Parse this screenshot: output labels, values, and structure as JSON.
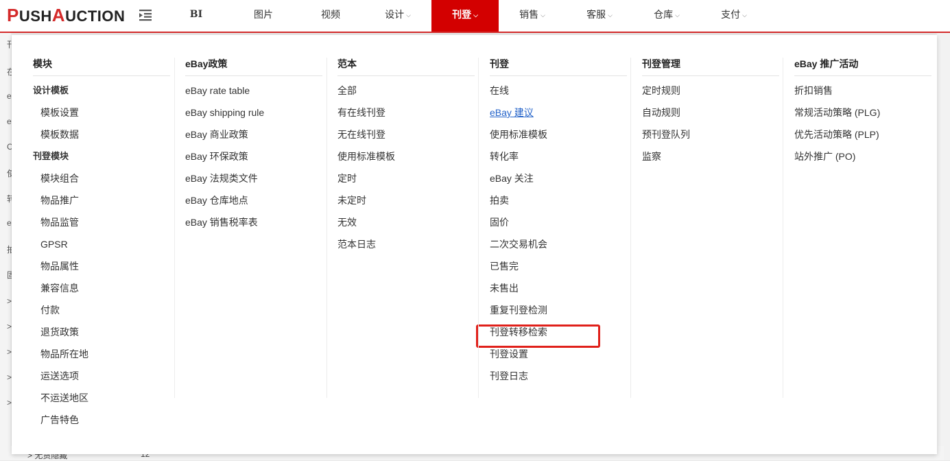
{
  "logo": {
    "p": "P",
    "ush": "USH",
    "a": "A",
    "uction": "UCTION"
  },
  "nav": [
    {
      "label": "BI",
      "dropdown": false
    },
    {
      "label": "图片",
      "dropdown": false
    },
    {
      "label": "视频",
      "dropdown": false
    },
    {
      "label": "设计",
      "dropdown": true
    },
    {
      "label": "刊登",
      "dropdown": true,
      "active": true
    },
    {
      "label": "销售",
      "dropdown": true
    },
    {
      "label": "客服",
      "dropdown": true
    },
    {
      "label": "仓库",
      "dropdown": true
    },
    {
      "label": "支付",
      "dropdown": true
    }
  ],
  "chevron": "⌵",
  "background": {
    "left_glyphs": [
      "刊",
      "在",
      "e",
      "e",
      "C",
      "使",
      "转",
      "e",
      "拍",
      "固",
      ">",
      ">",
      ">",
      ">",
      ">"
    ],
    "bottom_text": "> 无货隐藏",
    "bottom_count": "12"
  },
  "columns": [
    {
      "title": "模块",
      "entries": [
        {
          "type": "sub",
          "label": "设计模板"
        },
        {
          "type": "item",
          "label": "模板设置",
          "indent": true
        },
        {
          "type": "item",
          "label": "模板数据",
          "indent": true
        },
        {
          "type": "sub",
          "label": "刊登模块"
        },
        {
          "type": "item",
          "label": "模块组合",
          "indent": true
        },
        {
          "type": "item",
          "label": "物品推广",
          "indent": true
        },
        {
          "type": "item",
          "label": "物品监管",
          "indent": true
        },
        {
          "type": "item",
          "label": "GPSR",
          "indent": true
        },
        {
          "type": "item",
          "label": "物品属性",
          "indent": true
        },
        {
          "type": "item",
          "label": "兼容信息",
          "indent": true
        },
        {
          "type": "item",
          "label": "付款",
          "indent": true
        },
        {
          "type": "item",
          "label": "退货政策",
          "indent": true
        },
        {
          "type": "item",
          "label": "物品所在地",
          "indent": true
        },
        {
          "type": "item",
          "label": "运送选项",
          "indent": true
        },
        {
          "type": "item",
          "label": "不运送地区",
          "indent": true
        },
        {
          "type": "item",
          "label": "广告特色",
          "indent": true
        }
      ]
    },
    {
      "title": "eBay政策",
      "entries": [
        {
          "type": "item",
          "label": "eBay rate table"
        },
        {
          "type": "item",
          "label": "eBay shipping rule"
        },
        {
          "type": "item",
          "label": "eBay 商业政策"
        },
        {
          "type": "item",
          "label": "eBay 环保政策"
        },
        {
          "type": "item",
          "label": "eBay 法规类文件"
        },
        {
          "type": "item",
          "label": "eBay 仓库地点"
        },
        {
          "type": "item",
          "label": "eBay 销售税率表"
        }
      ]
    },
    {
      "title": "范本",
      "entries": [
        {
          "type": "item",
          "label": "全部"
        },
        {
          "type": "item",
          "label": "有在线刊登"
        },
        {
          "type": "item",
          "label": "无在线刊登"
        },
        {
          "type": "item",
          "label": "使用标准模板"
        },
        {
          "type": "item",
          "label": "定时"
        },
        {
          "type": "item",
          "label": "未定时"
        },
        {
          "type": "item",
          "label": "无效"
        },
        {
          "type": "item",
          "label": "范本日志"
        }
      ]
    },
    {
      "title": "刊登",
      "entries": [
        {
          "type": "item",
          "label": "在线"
        },
        {
          "type": "item",
          "label": "eBay 建议",
          "link": true
        },
        {
          "type": "item",
          "label": "使用标准模板"
        },
        {
          "type": "item",
          "label": "转化率"
        },
        {
          "type": "item",
          "label": "eBay 关注"
        },
        {
          "type": "item",
          "label": "拍卖"
        },
        {
          "type": "item",
          "label": "固价"
        },
        {
          "type": "item",
          "label": "二次交易机会"
        },
        {
          "type": "item",
          "label": "已售完"
        },
        {
          "type": "item",
          "label": "未售出"
        },
        {
          "type": "item",
          "label": "重复刊登检测"
        },
        {
          "type": "item",
          "label": "刊登转移检索",
          "highlight": true
        },
        {
          "type": "item",
          "label": "刊登设置"
        },
        {
          "type": "item",
          "label": "刊登日志"
        }
      ]
    },
    {
      "title": "刊登管理",
      "entries": [
        {
          "type": "item",
          "label": "定时规则"
        },
        {
          "type": "item",
          "label": "自动规则"
        },
        {
          "type": "item",
          "label": "预刊登队列"
        },
        {
          "type": "item",
          "label": "监察"
        }
      ]
    },
    {
      "title": "eBay 推广活动",
      "entries": [
        {
          "type": "item",
          "label": "折扣销售"
        },
        {
          "type": "item",
          "label": "常规活动策略 (PLG)"
        },
        {
          "type": "item",
          "label": "优先活动策略 (PLP)"
        },
        {
          "type": "item",
          "label": "站外推广 (PO)"
        }
      ]
    }
  ],
  "colors": {
    "accent": "#d30000",
    "link": "#2463c9",
    "highlight_border": "#e0201a"
  }
}
